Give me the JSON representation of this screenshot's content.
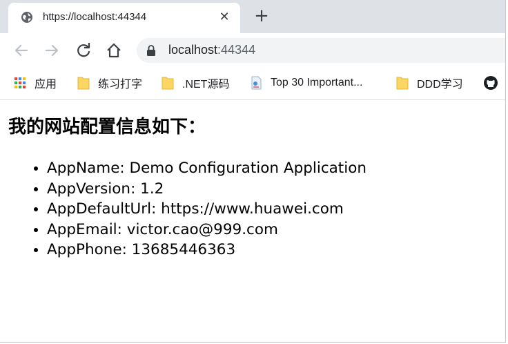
{
  "tab": {
    "title": "https://localhost:44344",
    "close_glyph": "✕",
    "new_tab_glyph": "+"
  },
  "toolbar": {
    "url_host": "localhost",
    "url_port": ":44344"
  },
  "bookmarks": [
    {
      "label": "应用",
      "icon": "apps-grid-icon"
    },
    {
      "label": "练习打字",
      "icon": "folder-icon"
    },
    {
      "label": ".NET源码",
      "icon": "folder-icon"
    },
    {
      "label": "Top 30 Important...",
      "icon": "page-icon"
    },
    {
      "label": "DDD学习",
      "icon": "folder-icon"
    },
    {
      "label": "",
      "icon": "github-icon"
    }
  ],
  "page": {
    "heading": "我的网站配置信息如下：",
    "items": [
      "AppName: Demo Configuration Application",
      "AppVersion: 1.2",
      "AppDefaultUrl: https://www.huawei.com",
      "AppEmail: victor.cao@999.com",
      "AppPhone: 13685446363"
    ]
  },
  "colors": {
    "tabstrip": "#dee1e6",
    "omnibox": "#f1f3f4",
    "folder": "#fcd663",
    "text": "#202124"
  }
}
